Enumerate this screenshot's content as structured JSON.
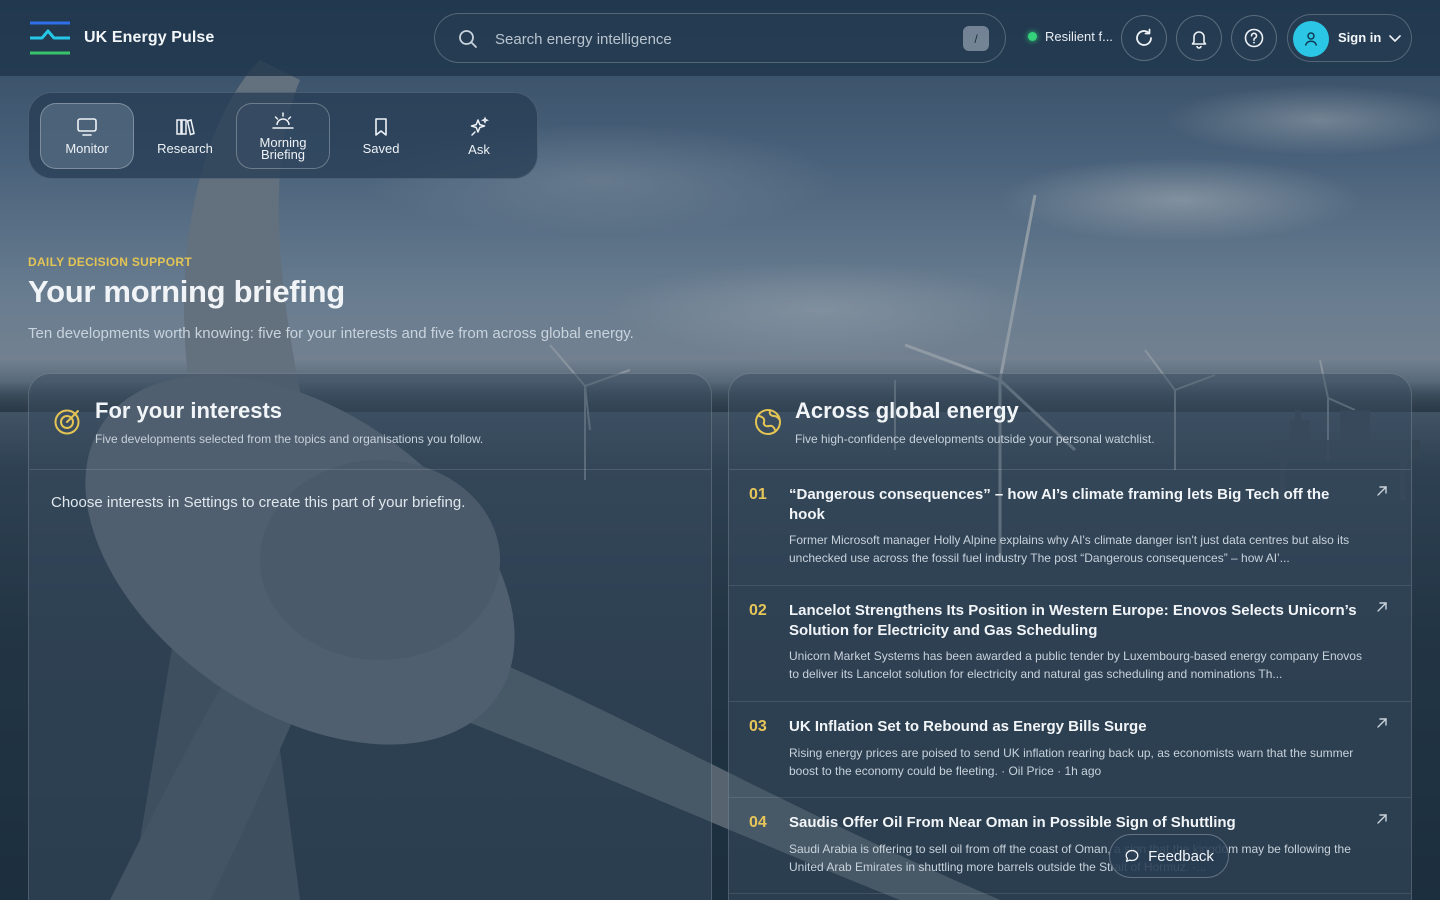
{
  "app": {
    "name": "UK Energy Pulse"
  },
  "search": {
    "placeholder": "Search energy intelligence",
    "shortcut": "/"
  },
  "status": {
    "text": "Resilient f...",
    "color": "#34d27a"
  },
  "header_icons": [
    "refresh-icon",
    "bell-icon",
    "help-icon"
  ],
  "account": {
    "label": "Sign in"
  },
  "nav": {
    "items": [
      {
        "label": "Monitor",
        "icon": "monitor-icon",
        "state": "active"
      },
      {
        "label": "Research",
        "icon": "books-icon",
        "state": ""
      },
      {
        "label": "Morning Briefing",
        "icon": "sunrise-icon",
        "state": "current"
      },
      {
        "label": "Saved",
        "icon": "bookmark-icon",
        "state": ""
      },
      {
        "label": "Ask",
        "icon": "sparkle-icon",
        "state": ""
      }
    ]
  },
  "hero": {
    "eyebrow": "DAILY DECISION SUPPORT",
    "title": "Your morning briefing",
    "subtitle": "Ten developments worth knowing: five for your interests and five from across global energy."
  },
  "interests": {
    "title": "For your interests",
    "subtitle": "Five developments selected from the topics and organisations you follow.",
    "empty_message": "Choose interests in Settings to create this part of your briefing."
  },
  "global": {
    "title": "Across global energy",
    "subtitle": "Five high-confidence developments outside your personal watchlist.",
    "items": [
      {
        "num": "01",
        "title": "“Dangerous consequences” – how AI’s climate framing lets Big Tech off the hook",
        "desc": "Former Microsoft manager Holly Alpine explains why AI's climate danger isn't just data centres but also its unchecked use across the fossil fuel industry The post “Dangerous consequences” – how AI’..."
      },
      {
        "num": "02",
        "title": "Lancelot Strengthens Its Position in Western Europe: Enovos Selects Unicorn’s Solution for Electricity and Gas Scheduling",
        "desc": "Unicorn Market Systems has been awarded a public tender by Luxembourg-based energy company Enovos to deliver its Lancelot solution for electricity and natural gas scheduling and nominations Th..."
      },
      {
        "num": "03",
        "title": "UK Inflation Set to Rebound as Energy Bills Surge",
        "desc": "Rising energy prices are poised to send UK inflation rearing back up, as economists warn that the summer boost to the economy could be fleeting. · Oil Price · 1h ago"
      },
      {
        "num": "04",
        "title": "Saudis Offer Oil From Near Oman in Possible Sign of Shuttling",
        "desc": "Saudi Arabia is offering to sell oil from off the coast of Oman, a sign that the kingdom may be following the United Arab Emirates in shuttling more barrels outside the Strait of Hormuz. ·..."
      }
    ]
  },
  "feedback": {
    "label": "Feedback"
  },
  "colors": {
    "accent_gold": "#e3c454",
    "avatar": "#2bc6e6",
    "status_green": "#34d27a"
  }
}
